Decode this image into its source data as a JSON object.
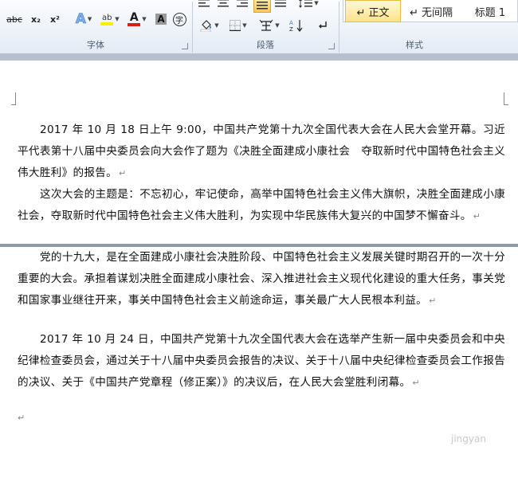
{
  "ribbon": {
    "font_group": {
      "label": "字体",
      "buttons": {
        "strikethrough": "abc",
        "subscript": "x₂",
        "superscript": "x²",
        "text_effects": "A",
        "highlight": "ab",
        "font_color": "A",
        "char_shading": "A",
        "enclose_char": "字"
      }
    },
    "paragraph_group": {
      "label": "段落"
    },
    "styles_group": {
      "label": "样式",
      "items": [
        {
          "label": "↵ 正文",
          "active": true
        },
        {
          "label": "↵ 无间隔",
          "active": false
        },
        {
          "label": "标题 1",
          "active": false
        }
      ]
    }
  },
  "document": {
    "paragraphs": [
      "2017 年 10 月 18 日上午 9:00，中国共产党第十九次全国代表大会在人民大会堂开幕。习近平代表第十八届中央委员会向大会作了题为《决胜全面建成小康社会　夺取新时代中国特色社会主义伟大胜利》的报告。",
      "这次大会的主题是：不忘初心，牢记使命，高举中国特色社会主义伟大旗帜，决胜全面建成小康社会，夺取新时代中国特色社会主义伟大胜利，为实现中华民族伟大复兴的中国梦不懈奋斗。",
      "党的十九大，是在全面建成小康社会决胜阶段、中国特色社会主义发展关键时期召开的一次十分重要的大会。承担着谋划决胜全面建成小康社会、深入推进社会主义现代化建设的重大任务，事关党和国家事业继往开来，事关中国特色社会主义前途命运，事关最广大人民根本利益。",
      "2017 年 10 月 24 日，中国共产党第十九次全国代表大会在选举产生新一届中央委员会和中央纪律检查委员会，通过关于十八届中央委员会报告的决议、关于十八届中央纪律检查委员会工作报告的决议、关于《中国共产党章程（修正案）》的决议后，在人民大会堂胜利闭幕。"
    ],
    "paragraph_mark": "↵"
  },
  "watermark": "jingyan",
  "colors": {
    "highlight_yellow": "#ffee00",
    "font_color_red": "#d32020",
    "ribbon_label": "#4a5a6e",
    "page_break": "#8f99a6"
  }
}
